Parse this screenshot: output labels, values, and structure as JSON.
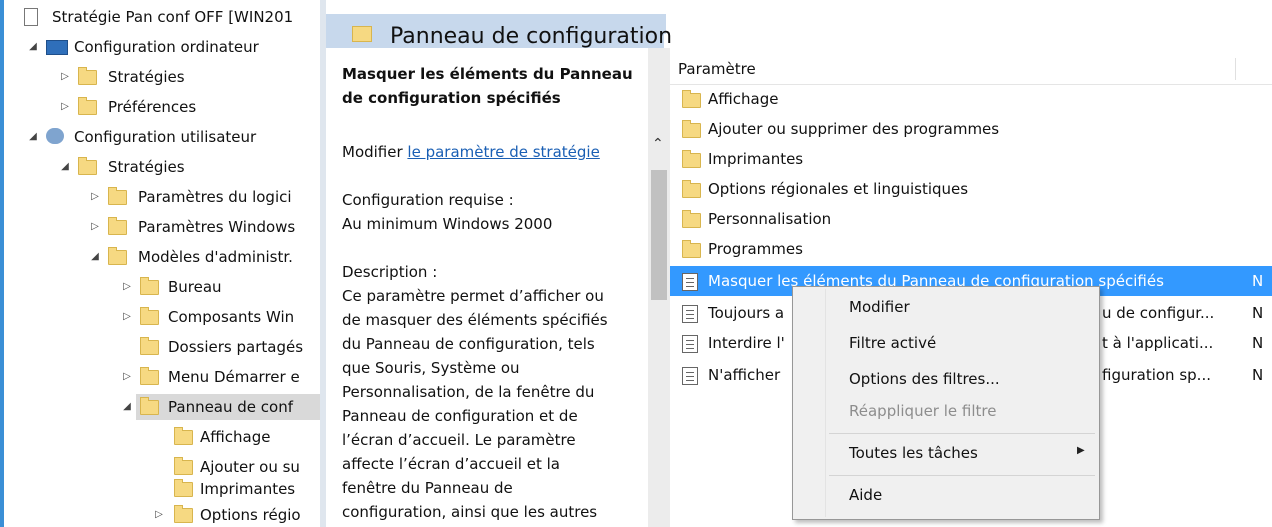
{
  "tree": {
    "items": [
      {
        "label": "Stratégie Pan conf OFF [WIN201",
        "arrow": "",
        "kind": "policy"
      },
      {
        "label": "Configuration ordinateur",
        "arrow": "◢",
        "kind": "computer"
      },
      {
        "label": "Stratégies",
        "arrow": "▷",
        "kind": "folder"
      },
      {
        "label": "Préférences",
        "arrow": "▷",
        "kind": "folder"
      },
      {
        "label": "Configuration utilisateur",
        "arrow": "◢",
        "kind": "users"
      },
      {
        "label": "Stratégies",
        "arrow": "◢",
        "kind": "folder"
      },
      {
        "label": "Paramètres du logici",
        "arrow": "▷",
        "kind": "folder"
      },
      {
        "label": "Paramètres Windows",
        "arrow": "▷",
        "kind": "folder"
      },
      {
        "label": "Modèles d'administr.",
        "arrow": "◢",
        "kind": "folder"
      },
      {
        "label": "Bureau",
        "arrow": "▷",
        "kind": "folder"
      },
      {
        "label": "Composants Win",
        "arrow": "▷",
        "kind": "folder"
      },
      {
        "label": "Dossiers partagés",
        "arrow": "",
        "kind": "folder"
      },
      {
        "label": "Menu Démarrer e",
        "arrow": "▷",
        "kind": "folder"
      },
      {
        "label": "Panneau de conf",
        "arrow": "◢",
        "kind": "folder"
      },
      {
        "label": "Affichage",
        "arrow": "",
        "kind": "folder"
      },
      {
        "label": "Ajouter ou su",
        "arrow": "",
        "kind": "folder"
      },
      {
        "label": "Imprimantes",
        "arrow": "",
        "kind": "folder"
      },
      {
        "label": "Options régio",
        "arrow": "▷",
        "kind": "folder"
      }
    ]
  },
  "header": {
    "title": "Panneau de configuration"
  },
  "description": {
    "title": "Masquer les éléments du Panneau de configuration spécifiés",
    "edit_prefix": "Modifier ",
    "edit_link": "le paramètre de stratégie",
    "req_label": "Configuration requise :",
    "req_value": "Au minimum Windows 2000",
    "desc_label": "Description :",
    "desc_lines": [
      "Ce paramètre permet d’afficher ou",
      "de masquer des éléments spécifiés",
      "du Panneau de configuration, tels",
      "que Souris, Système ou",
      "Personnalisation, de la fenêtre du",
      "Panneau de configuration et de",
      "l’écran d’accueil. Le paramètre",
      "affecte l’écran d’accueil et la",
      "fenêtre du Panneau de",
      "configuration, ainsi que les autres"
    ]
  },
  "list": {
    "column_header": "Paramètre",
    "rows": [
      {
        "label": "Affichage",
        "state": "",
        "kind": "folder"
      },
      {
        "label": "Ajouter ou supprimer des programmes",
        "state": "",
        "kind": "folder"
      },
      {
        "label": "Imprimantes",
        "state": "",
        "kind": "folder"
      },
      {
        "label": "Options régionales et linguistiques",
        "state": "",
        "kind": "folder"
      },
      {
        "label": "Personnalisation",
        "state": "",
        "kind": "folder"
      },
      {
        "label": "Programmes",
        "state": "",
        "kind": "folder"
      },
      {
        "label": "Masquer les éléments du Panneau de configuration spécifiés",
        "state": "N",
        "kind": "setting"
      },
      {
        "label": "Toujours afficher ... Panneau de configur...",
        "state": "N",
        "kind": "setting"
      },
      {
        "label": "Interdire l'accès au Panneau ... et à l'applicati...",
        "state": "N",
        "kind": "setting"
      },
      {
        "label": "N'afficher que les éléments ... configuration sp...",
        "state": "N",
        "kind": "setting"
      }
    ],
    "visible_fragments": {
      "row7": {
        "left": "Toujours a",
        "right": "u de configur..."
      },
      "row8": {
        "left": "Interdire l'",
        "right": "t à l'applicati..."
      },
      "row9": {
        "left": "N'afficher",
        "right": "figuration sp..."
      }
    }
  },
  "context_menu": {
    "items": [
      {
        "label": "Modifier",
        "enabled": true
      },
      {
        "label": "Filtre activé",
        "enabled": true
      },
      {
        "label": "Options des filtres...",
        "enabled": true
      },
      {
        "label": "Réappliquer le filtre",
        "enabled": false
      },
      {
        "label": "Toutes les tâches",
        "enabled": true,
        "submenu": true
      },
      {
        "label": "Aide",
        "enabled": true
      }
    ]
  },
  "colors": {
    "selection": "#3399ff",
    "header_band": "#c7d8ec",
    "folder": "#f6d982",
    "link": "#1a5fb4"
  }
}
